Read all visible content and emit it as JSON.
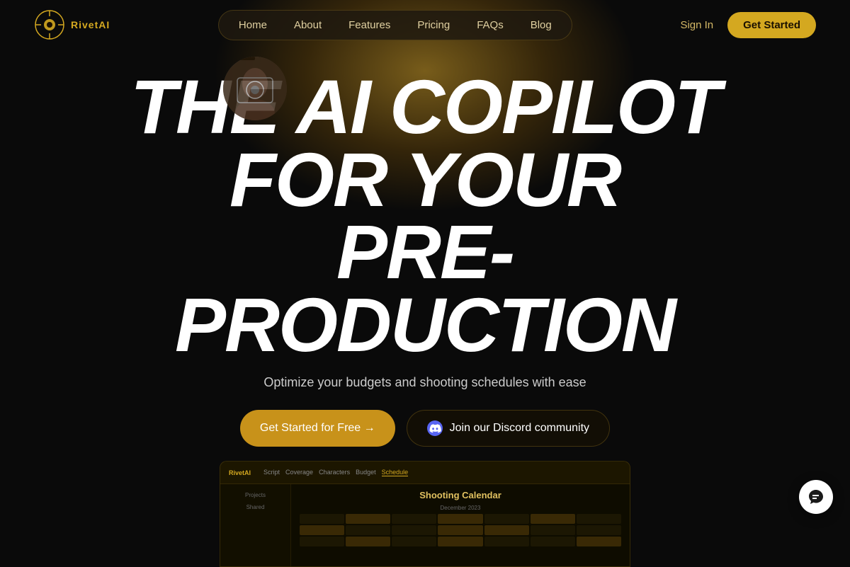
{
  "meta": {
    "title": "RivetAI — The AI Copilot for Pre-Production"
  },
  "logo": {
    "text": "RivetAI",
    "icon_label": "rivetai-logo-icon"
  },
  "nav": {
    "links": [
      {
        "label": "Home",
        "key": "home"
      },
      {
        "label": "About",
        "key": "about"
      },
      {
        "label": "Features",
        "key": "features"
      },
      {
        "label": "Pricing",
        "key": "pricing"
      },
      {
        "label": "FAQs",
        "key": "faqs"
      },
      {
        "label": "Blog",
        "key": "blog"
      }
    ],
    "sign_in_label": "Sign In",
    "get_started_label": "Get Started"
  },
  "hero": {
    "title_line1": "THE AI COPILOT",
    "title_line2": "FOR YOUR",
    "title_line3": "PRE-PRODUCTION",
    "subtitle": "Optimize your budgets and shooting schedules with ease",
    "cta_primary": "Get Started for Free →",
    "cta_secondary": "Join our Discord community",
    "discord_icon_label": "discord-icon"
  },
  "preview": {
    "logo": "RivetAI",
    "tabs": [
      "Script",
      "Coverage",
      "Characters",
      "Budget",
      "Schedule"
    ],
    "active_tab": "Schedule",
    "sidebar_items": [
      "Projects",
      "Shared"
    ],
    "heading": "Shooting Calendar",
    "month_label": "December 2023"
  },
  "chat": {
    "icon_label": "chat-bubble-icon"
  }
}
